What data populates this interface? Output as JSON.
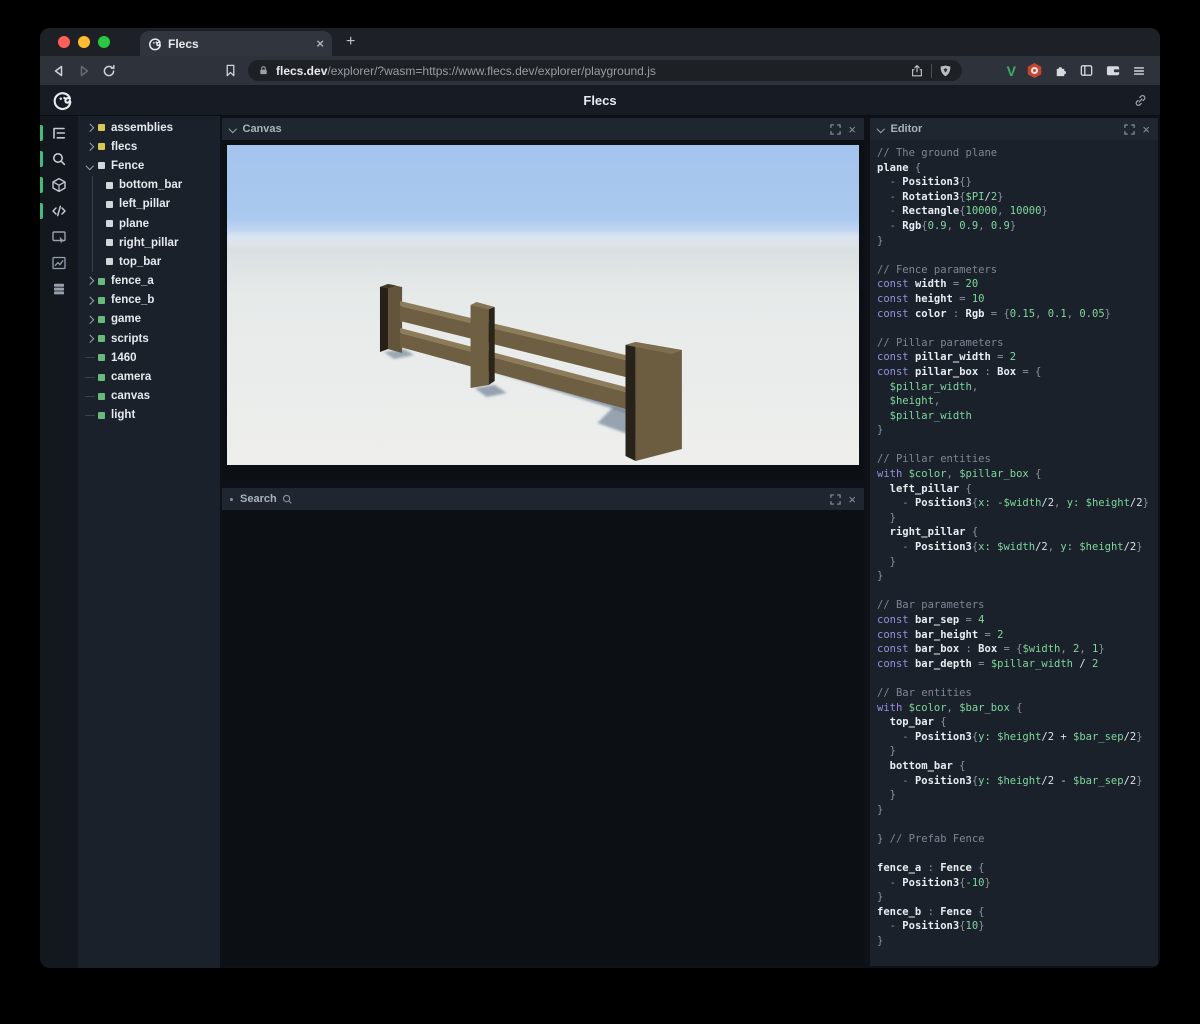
{
  "browser": {
    "tab": {
      "title": "Flecs",
      "close_label": "×"
    },
    "new_tab_label": "+",
    "address": {
      "host": "flecs.dev",
      "path": "/explorer/?wasm=https://www.flecs.dev/explorer/playground.js"
    }
  },
  "app": {
    "header": {
      "title": "Flecs"
    },
    "activity_bar": {
      "items": [
        {
          "name": "entity-tree",
          "active": true
        },
        {
          "name": "search",
          "active": true
        },
        {
          "name": "scene",
          "active": true
        },
        {
          "name": "code",
          "active": true
        },
        {
          "name": "screen-capture",
          "active": false
        },
        {
          "name": "stats",
          "active": false
        },
        {
          "name": "tables",
          "active": false
        }
      ]
    },
    "tree": {
      "items": [
        {
          "label": "assemblies",
          "dot": "yellow",
          "marker": "collapsed"
        },
        {
          "label": "flecs",
          "dot": "yellow",
          "marker": "collapsed"
        },
        {
          "label": "Fence",
          "dot": "white",
          "marker": "expanded"
        },
        {
          "label": "bottom_bar",
          "dot": "white",
          "marker": "child"
        },
        {
          "label": "left_pillar",
          "dot": "white",
          "marker": "child"
        },
        {
          "label": "plane",
          "dot": "white",
          "marker": "child"
        },
        {
          "label": "right_pillar",
          "dot": "white",
          "marker": "child"
        },
        {
          "label": "top_bar",
          "dot": "white",
          "marker": "child"
        },
        {
          "label": "fence_a",
          "dot": "green",
          "marker": "collapsed"
        },
        {
          "label": "fence_b",
          "dot": "green",
          "marker": "collapsed"
        },
        {
          "label": "game",
          "dot": "green",
          "marker": "collapsed"
        },
        {
          "label": "scripts",
          "dot": "green",
          "marker": "collapsed"
        },
        {
          "label": "1460",
          "dot": "green",
          "marker": "leaf"
        },
        {
          "label": "camera",
          "dot": "green",
          "marker": "leaf"
        },
        {
          "label": "canvas",
          "dot": "green",
          "marker": "leaf"
        },
        {
          "label": "light",
          "dot": "green",
          "marker": "leaf"
        }
      ]
    },
    "panels": {
      "canvas": {
        "title": "Canvas"
      },
      "search": {
        "title": "Search"
      },
      "editor": {
        "title": "Editor",
        "code_lines": [
          [
            [
              "c",
              "// The ground plane"
            ]
          ],
          [
            [
              "i",
              "plane"
            ],
            [
              "p",
              " {"
            ]
          ],
          [
            [
              "p",
              "  - "
            ],
            [
              "i",
              "Position3"
            ],
            [
              "p",
              "{}"
            ]
          ],
          [
            [
              "p",
              "  - "
            ],
            [
              "i",
              "Rotation3"
            ],
            [
              "p",
              "{"
            ],
            [
              "g",
              "$PI"
            ],
            [
              "w",
              "/"
            ],
            [
              "g",
              "2"
            ],
            [
              "p",
              "}"
            ]
          ],
          [
            [
              "p",
              "  - "
            ],
            [
              "i",
              "Rectangle"
            ],
            [
              "p",
              "{"
            ],
            [
              "g",
              "10000"
            ],
            [
              "p",
              ", "
            ],
            [
              "g",
              "10000"
            ],
            [
              "p",
              "}"
            ]
          ],
          [
            [
              "p",
              "  - "
            ],
            [
              "i",
              "Rgb"
            ],
            [
              "p",
              "{"
            ],
            [
              "g",
              "0.9"
            ],
            [
              "p",
              ", "
            ],
            [
              "g",
              "0.9"
            ],
            [
              "p",
              ", "
            ],
            [
              "g",
              "0.9"
            ],
            [
              "p",
              "}"
            ]
          ],
          [
            [
              "p",
              "}"
            ]
          ],
          [],
          [
            [
              "c",
              "// Fence parameters"
            ]
          ],
          [
            [
              "k",
              "const "
            ],
            [
              "i",
              "width"
            ],
            [
              "p",
              " = "
            ],
            [
              "g",
              "20"
            ]
          ],
          [
            [
              "k",
              "const "
            ],
            [
              "i",
              "height"
            ],
            [
              "p",
              " = "
            ],
            [
              "g",
              "10"
            ]
          ],
          [
            [
              "k",
              "const "
            ],
            [
              "i",
              "color"
            ],
            [
              "p",
              " : "
            ],
            [
              "i",
              "Rgb"
            ],
            [
              "p",
              " = {"
            ],
            [
              "g",
              "0.15"
            ],
            [
              "p",
              ", "
            ],
            [
              "g",
              "0.1"
            ],
            [
              "p",
              ", "
            ],
            [
              "g",
              "0.05"
            ],
            [
              "p",
              "}"
            ]
          ],
          [],
          [
            [
              "c",
              "// Pillar parameters"
            ]
          ],
          [
            [
              "k",
              "const "
            ],
            [
              "i",
              "pillar_width"
            ],
            [
              "p",
              " = "
            ],
            [
              "g",
              "2"
            ]
          ],
          [
            [
              "k",
              "const "
            ],
            [
              "i",
              "pillar_box"
            ],
            [
              "p",
              " : "
            ],
            [
              "i",
              "Box"
            ],
            [
              "p",
              " = {"
            ]
          ],
          [
            [
              "g",
              "  $pillar_width"
            ],
            [
              "p",
              ","
            ]
          ],
          [
            [
              "g",
              "  $height"
            ],
            [
              "p",
              ","
            ]
          ],
          [
            [
              "g",
              "  $pillar_width"
            ]
          ],
          [
            [
              "p",
              "}"
            ]
          ],
          [],
          [
            [
              "c",
              "// Pillar entities"
            ]
          ],
          [
            [
              "k",
              "with "
            ],
            [
              "g",
              "$color"
            ],
            [
              "p",
              ", "
            ],
            [
              "g",
              "$pillar_box"
            ],
            [
              "p",
              " {"
            ]
          ],
          [
            [
              "i",
              "  left_pillar"
            ],
            [
              "p",
              " {"
            ]
          ],
          [
            [
              "p",
              "    - "
            ],
            [
              "i",
              "Position3"
            ],
            [
              "p",
              "{"
            ],
            [
              "g",
              "x: -$width"
            ],
            [
              "w",
              "/2"
            ],
            [
              "p",
              ","
            ],
            [
              "g",
              " y: $height"
            ],
            [
              "w",
              "/2"
            ],
            [
              "p",
              "}"
            ]
          ],
          [
            [
              "p",
              "  }"
            ]
          ],
          [
            [
              "i",
              "  right_pillar"
            ],
            [
              "p",
              " {"
            ]
          ],
          [
            [
              "p",
              "    - "
            ],
            [
              "i",
              "Position3"
            ],
            [
              "p",
              "{"
            ],
            [
              "g",
              "x: $width"
            ],
            [
              "w",
              "/2"
            ],
            [
              "p",
              ","
            ],
            [
              "g",
              " y: $height"
            ],
            [
              "w",
              "/2"
            ],
            [
              "p",
              "}"
            ]
          ],
          [
            [
              "p",
              "  }"
            ]
          ],
          [
            [
              "p",
              "}"
            ]
          ],
          [],
          [
            [
              "c",
              "// Bar parameters"
            ]
          ],
          [
            [
              "k",
              "const "
            ],
            [
              "i",
              "bar_sep"
            ],
            [
              "p",
              " = "
            ],
            [
              "g",
              "4"
            ]
          ],
          [
            [
              "k",
              "const "
            ],
            [
              "i",
              "bar_height"
            ],
            [
              "p",
              " = "
            ],
            [
              "g",
              "2"
            ]
          ],
          [
            [
              "k",
              "const "
            ],
            [
              "i",
              "bar_box"
            ],
            [
              "p",
              " : "
            ],
            [
              "i",
              "Box"
            ],
            [
              "p",
              " = {"
            ],
            [
              "g",
              "$width"
            ],
            [
              "p",
              ", "
            ],
            [
              "g",
              "2"
            ],
            [
              "p",
              ", "
            ],
            [
              "g",
              "1"
            ],
            [
              "p",
              "}"
            ]
          ],
          [
            [
              "k",
              "const "
            ],
            [
              "i",
              "bar_depth"
            ],
            [
              "p",
              " = "
            ],
            [
              "g",
              "$pillar_width"
            ],
            [
              "w",
              " / "
            ],
            [
              "g",
              "2"
            ]
          ],
          [],
          [
            [
              "c",
              "// Bar entities"
            ]
          ],
          [
            [
              "k",
              "with "
            ],
            [
              "g",
              "$color"
            ],
            [
              "p",
              ", "
            ],
            [
              "g",
              "$bar_box"
            ],
            [
              "p",
              " {"
            ]
          ],
          [
            [
              "i",
              "  top_bar"
            ],
            [
              "p",
              " {"
            ]
          ],
          [
            [
              "p",
              "    - "
            ],
            [
              "i",
              "Position3"
            ],
            [
              "p",
              "{"
            ],
            [
              "g",
              "y: $height"
            ],
            [
              "w",
              "/2 + "
            ],
            [
              "g",
              "$bar_sep"
            ],
            [
              "w",
              "/2"
            ],
            [
              "p",
              "}"
            ]
          ],
          [
            [
              "p",
              "  }"
            ]
          ],
          [
            [
              "i",
              "  bottom_bar"
            ],
            [
              "p",
              " {"
            ]
          ],
          [
            [
              "p",
              "    - "
            ],
            [
              "i",
              "Position3"
            ],
            [
              "p",
              "{"
            ],
            [
              "g",
              "y: $height"
            ],
            [
              "w",
              "/2 - "
            ],
            [
              "g",
              "$bar_sep"
            ],
            [
              "w",
              "/2"
            ],
            [
              "p",
              "}"
            ]
          ],
          [
            [
              "p",
              "  }"
            ]
          ],
          [
            [
              "p",
              "}"
            ]
          ],
          [],
          [
            [
              "p",
              "} "
            ],
            [
              "c",
              "// Prefab Fence"
            ]
          ],
          [],
          [
            [
              "i",
              "fence_a"
            ],
            [
              "p",
              " : "
            ],
            [
              "i",
              "Fence"
            ],
            [
              "p",
              " {"
            ]
          ],
          [
            [
              "p",
              "  - "
            ],
            [
              "i",
              "Position3"
            ],
            [
              "p",
              "{"
            ],
            [
              "g",
              "-10"
            ],
            [
              "p",
              "}"
            ]
          ],
          [
            [
              "p",
              "}"
            ]
          ],
          [
            [
              "i",
              "fence_b"
            ],
            [
              "p",
              " : "
            ],
            [
              "i",
              "Fence"
            ],
            [
              "p",
              " {"
            ]
          ],
          [
            [
              "p",
              "  - "
            ],
            [
              "i",
              "Position3"
            ],
            [
              "p",
              "{"
            ],
            [
              "g",
              "10"
            ],
            [
              "p",
              "}"
            ]
          ],
          [
            [
              "p",
              "}"
            ]
          ]
        ]
      }
    },
    "colors": {
      "accent_green": "#3fbf7f",
      "dot_yellow": "#d8c750",
      "dot_white": "#d3d7dc",
      "dot_green": "#67b97c",
      "sky": "#a3c4ed",
      "ground": "#e6eae9",
      "wood": "#6c5d41",
      "wood_dark": "#28221a",
      "shadow": "#5d6f88",
      "traffic_red": "#ff5f57",
      "traffic_yellow": "#febc2e",
      "traffic_green": "#2ac840"
    }
  }
}
